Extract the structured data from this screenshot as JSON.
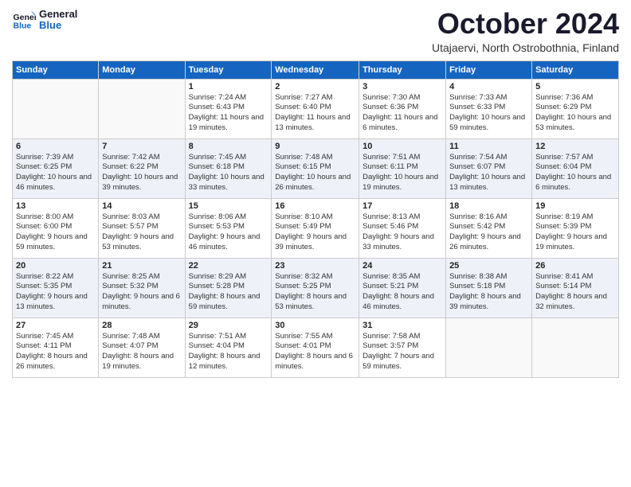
{
  "logo": {
    "line1": "General",
    "line2": "Blue"
  },
  "title": "October 2024",
  "subtitle": "Utajaervi, North Ostrobothnia, Finland",
  "days_of_week": [
    "Sunday",
    "Monday",
    "Tuesday",
    "Wednesday",
    "Thursday",
    "Friday",
    "Saturday"
  ],
  "weeks": [
    [
      {
        "num": "",
        "info": ""
      },
      {
        "num": "",
        "info": ""
      },
      {
        "num": "1",
        "info": "Sunrise: 7:24 AM\nSunset: 6:43 PM\nDaylight: 11 hours and 19 minutes."
      },
      {
        "num": "2",
        "info": "Sunrise: 7:27 AM\nSunset: 6:40 PM\nDaylight: 11 hours and 13 minutes."
      },
      {
        "num": "3",
        "info": "Sunrise: 7:30 AM\nSunset: 6:36 PM\nDaylight: 11 hours and 6 minutes."
      },
      {
        "num": "4",
        "info": "Sunrise: 7:33 AM\nSunset: 6:33 PM\nDaylight: 10 hours and 59 minutes."
      },
      {
        "num": "5",
        "info": "Sunrise: 7:36 AM\nSunset: 6:29 PM\nDaylight: 10 hours and 53 minutes."
      }
    ],
    [
      {
        "num": "6",
        "info": "Sunrise: 7:39 AM\nSunset: 6:25 PM\nDaylight: 10 hours and 46 minutes."
      },
      {
        "num": "7",
        "info": "Sunrise: 7:42 AM\nSunset: 6:22 PM\nDaylight: 10 hours and 39 minutes."
      },
      {
        "num": "8",
        "info": "Sunrise: 7:45 AM\nSunset: 6:18 PM\nDaylight: 10 hours and 33 minutes."
      },
      {
        "num": "9",
        "info": "Sunrise: 7:48 AM\nSunset: 6:15 PM\nDaylight: 10 hours and 26 minutes."
      },
      {
        "num": "10",
        "info": "Sunrise: 7:51 AM\nSunset: 6:11 PM\nDaylight: 10 hours and 19 minutes."
      },
      {
        "num": "11",
        "info": "Sunrise: 7:54 AM\nSunset: 6:07 PM\nDaylight: 10 hours and 13 minutes."
      },
      {
        "num": "12",
        "info": "Sunrise: 7:57 AM\nSunset: 6:04 PM\nDaylight: 10 hours and 6 minutes."
      }
    ],
    [
      {
        "num": "13",
        "info": "Sunrise: 8:00 AM\nSunset: 6:00 PM\nDaylight: 9 hours and 59 minutes."
      },
      {
        "num": "14",
        "info": "Sunrise: 8:03 AM\nSunset: 5:57 PM\nDaylight: 9 hours and 53 minutes."
      },
      {
        "num": "15",
        "info": "Sunrise: 8:06 AM\nSunset: 5:53 PM\nDaylight: 9 hours and 46 minutes."
      },
      {
        "num": "16",
        "info": "Sunrise: 8:10 AM\nSunset: 5:49 PM\nDaylight: 9 hours and 39 minutes."
      },
      {
        "num": "17",
        "info": "Sunrise: 8:13 AM\nSunset: 5:46 PM\nDaylight: 9 hours and 33 minutes."
      },
      {
        "num": "18",
        "info": "Sunrise: 8:16 AM\nSunset: 5:42 PM\nDaylight: 9 hours and 26 minutes."
      },
      {
        "num": "19",
        "info": "Sunrise: 8:19 AM\nSunset: 5:39 PM\nDaylight: 9 hours and 19 minutes."
      }
    ],
    [
      {
        "num": "20",
        "info": "Sunrise: 8:22 AM\nSunset: 5:35 PM\nDaylight: 9 hours and 13 minutes."
      },
      {
        "num": "21",
        "info": "Sunrise: 8:25 AM\nSunset: 5:32 PM\nDaylight: 9 hours and 6 minutes."
      },
      {
        "num": "22",
        "info": "Sunrise: 8:29 AM\nSunset: 5:28 PM\nDaylight: 8 hours and 59 minutes."
      },
      {
        "num": "23",
        "info": "Sunrise: 8:32 AM\nSunset: 5:25 PM\nDaylight: 8 hours and 53 minutes."
      },
      {
        "num": "24",
        "info": "Sunrise: 8:35 AM\nSunset: 5:21 PM\nDaylight: 8 hours and 46 minutes."
      },
      {
        "num": "25",
        "info": "Sunrise: 8:38 AM\nSunset: 5:18 PM\nDaylight: 8 hours and 39 minutes."
      },
      {
        "num": "26",
        "info": "Sunrise: 8:41 AM\nSunset: 5:14 PM\nDaylight: 8 hours and 32 minutes."
      }
    ],
    [
      {
        "num": "27",
        "info": "Sunrise: 7:45 AM\nSunset: 4:11 PM\nDaylight: 8 hours and 26 minutes."
      },
      {
        "num": "28",
        "info": "Sunrise: 7:48 AM\nSunset: 4:07 PM\nDaylight: 8 hours and 19 minutes."
      },
      {
        "num": "29",
        "info": "Sunrise: 7:51 AM\nSunset: 4:04 PM\nDaylight: 8 hours and 12 minutes."
      },
      {
        "num": "30",
        "info": "Sunrise: 7:55 AM\nSunset: 4:01 PM\nDaylight: 8 hours and 6 minutes."
      },
      {
        "num": "31",
        "info": "Sunrise: 7:58 AM\nSunset: 3:57 PM\nDaylight: 7 hours and 59 minutes."
      },
      {
        "num": "",
        "info": ""
      },
      {
        "num": "",
        "info": ""
      }
    ]
  ]
}
